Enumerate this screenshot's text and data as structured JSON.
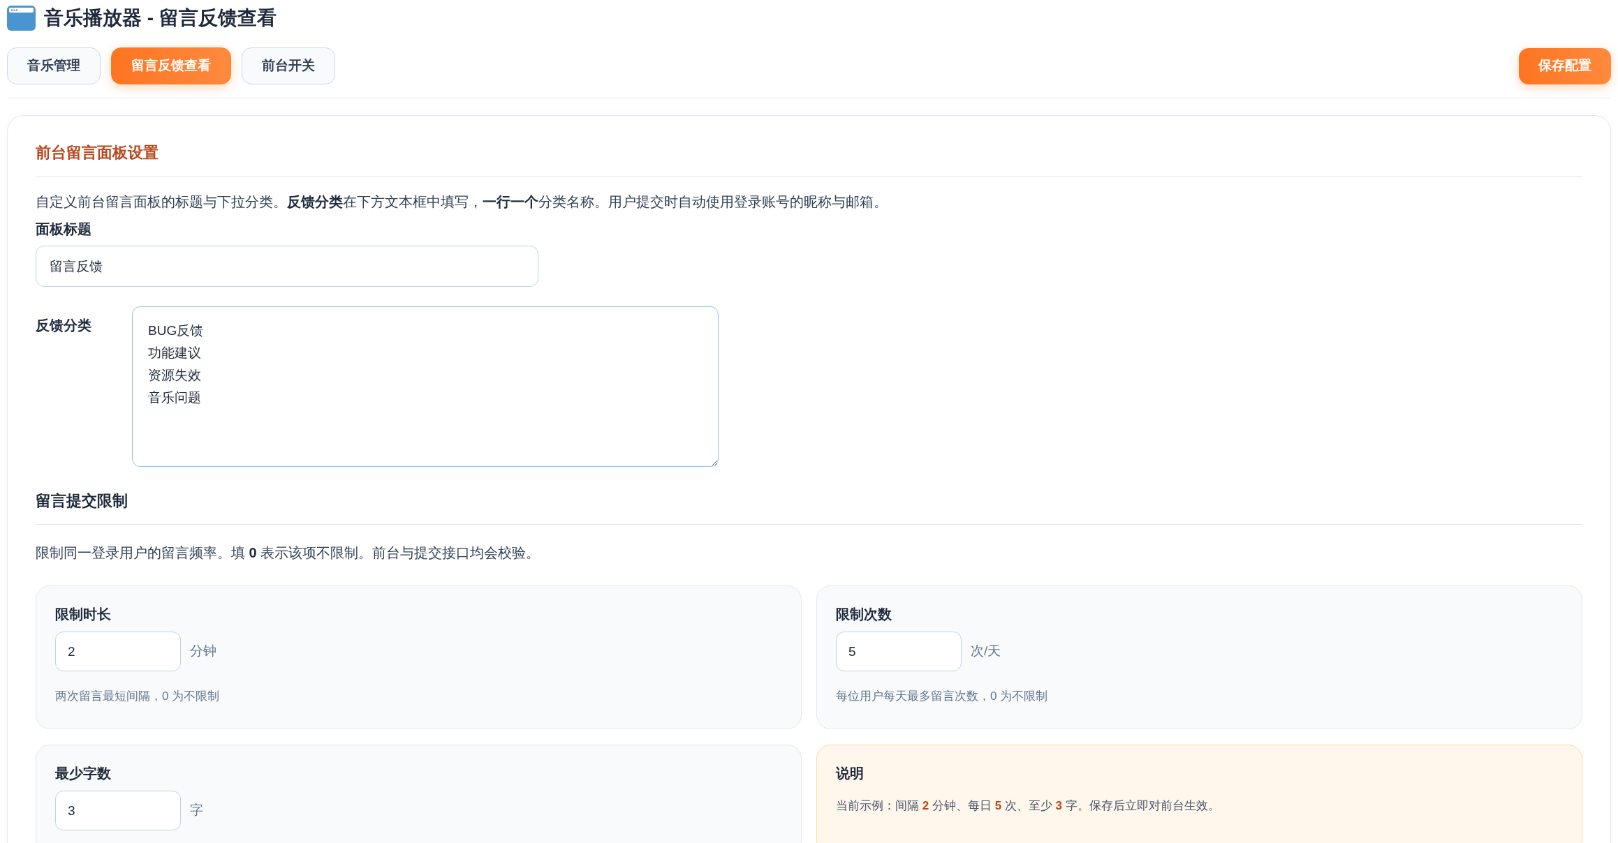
{
  "header": {
    "title": "音乐播放器 - 留言反馈查看"
  },
  "tabs": [
    {
      "label": "音乐管理",
      "selected": false
    },
    {
      "label": "留言反馈查看",
      "selected": true
    },
    {
      "label": "前台开关",
      "selected": false
    }
  ],
  "save_button": {
    "label": "保存配置"
  },
  "panel_section": {
    "title": "前台留言面板设置",
    "description": "自定义前台留言面板的标题与下拉分类。**反馈分类**在下方文本框中填写，**一行一个**分类名称。用户提交时自动使用登录账号的昵称与邮箱。",
    "panel_title": {
      "label": "面板标题",
      "value": "留言反馈"
    },
    "categories": {
      "label": "反馈分类",
      "value": [
        "BUG反馈",
        "功能建议",
        "资源失效",
        "音乐问题"
      ]
    }
  },
  "limit_section": {
    "title": "留言提交限制",
    "description": "限制同一登录用户的留言频率。填 **0** 表示该项不限制。前台与提交接口均会校验。",
    "cards": [
      {
        "kind": "field",
        "label": "限制时长",
        "value": "2",
        "unit": "分钟",
        "hint": "两次留言最短间隔，0 为不限制"
      },
      {
        "kind": "field",
        "label": "限制次数",
        "value": "5",
        "unit": "次/天",
        "hint": "每位用户每天最多留言次数，0 为不限制"
      },
      {
        "kind": "field",
        "label": "最少字数",
        "value": "3",
        "unit": "字"
      },
      {
        "kind": "note",
        "title": "说明",
        "text": "当前示例：间隔 **2** 分钟、每日 **5** 次、至少 **3** 字。保存后立即对前台生效。"
      }
    ]
  }
}
